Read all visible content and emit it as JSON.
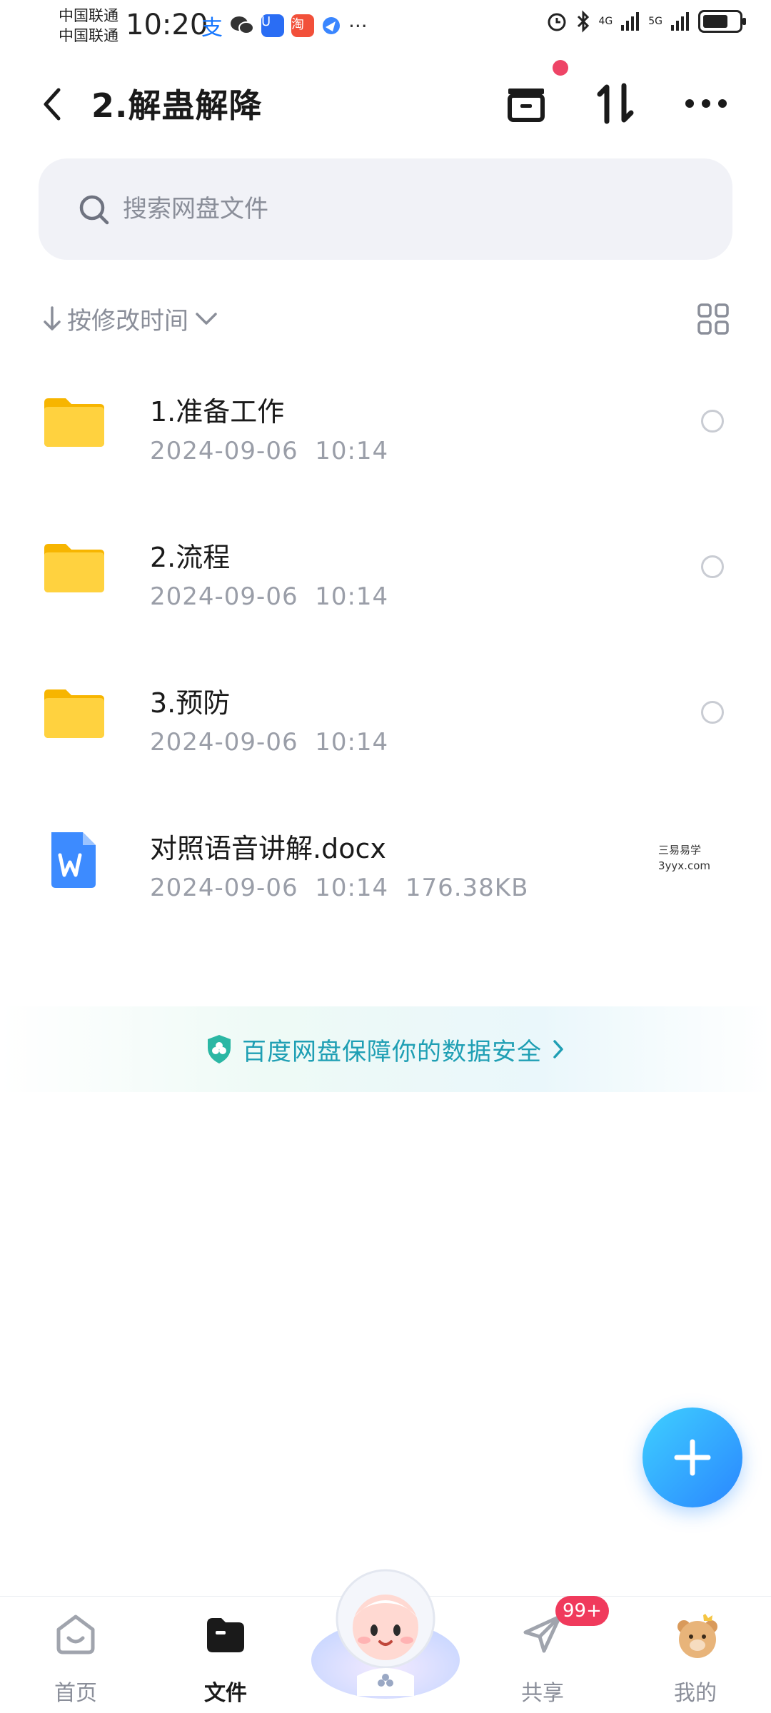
{
  "status_bar": {
    "carrier1": "中国联通",
    "carrier2": "中国联通",
    "time": "10:20",
    "net1": "4G",
    "net2": "5G"
  },
  "header": {
    "title": "2.解蛊解降"
  },
  "search": {
    "placeholder": "搜索网盘文件"
  },
  "sort": {
    "label": "按修改时间"
  },
  "files": [
    {
      "name": "1.准备工作",
      "date": "2024-09-06  10:14",
      "size": "",
      "type": "folder"
    },
    {
      "name": "2.流程",
      "date": "2024-09-06  10:14",
      "size": "",
      "type": "folder"
    },
    {
      "name": "3.预防",
      "date": "2024-09-06  10:14",
      "size": "",
      "type": "folder"
    },
    {
      "name": "对照语音讲解.docx",
      "date": "2024-09-06  10:14",
      "size": "176.38KB",
      "type": "docx"
    }
  ],
  "watermark": {
    "line1": "三易易学",
    "line2": "3yyx.com"
  },
  "safety_banner": {
    "text": "百度网盘保障你的数据安全"
  },
  "nav": {
    "home": "首页",
    "files": "文件",
    "share": "共享",
    "mine": "我的",
    "share_badge": "99+"
  },
  "colors": {
    "accent": "#2a86ff",
    "folder": "#ffcc33",
    "banner_text": "#1f9fb4",
    "badge": "#f03a5c"
  }
}
